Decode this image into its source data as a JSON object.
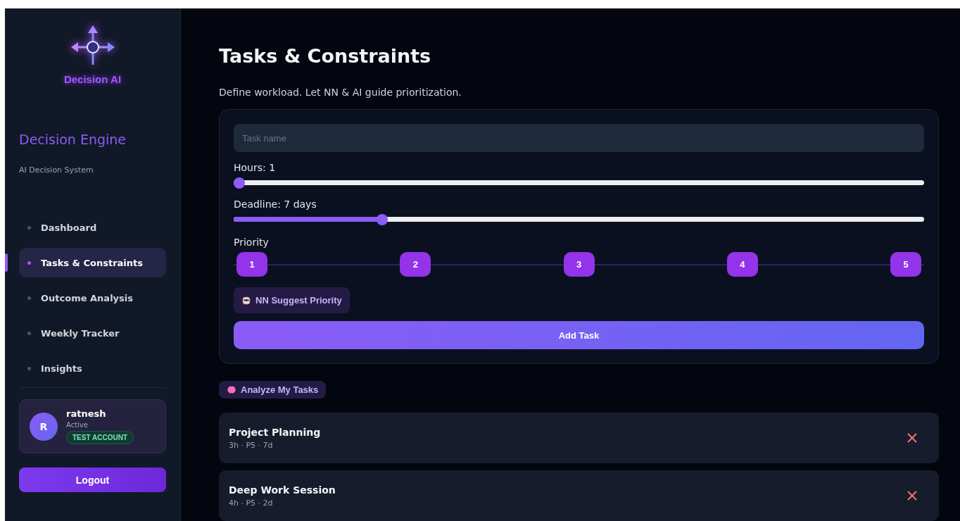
{
  "sidebar": {
    "logo_text": "Decision AI",
    "title": "Decision Engine",
    "subtitle": "AI Decision System",
    "nav": [
      {
        "label": "Dashboard",
        "selected": false
      },
      {
        "label": "Tasks & Constraints",
        "selected": true
      },
      {
        "label": "Outcome Analysis",
        "selected": false
      },
      {
        "label": "Weekly Tracker",
        "selected": false
      },
      {
        "label": "Insights",
        "selected": false
      }
    ],
    "user": {
      "initial": "R",
      "name": "ratnesh",
      "status": "Active",
      "badge": "TEST ACCOUNT"
    },
    "logout": "Logout"
  },
  "main": {
    "title": "Tasks & Constraints",
    "subtitle": "Define workload. Let NN & AI guide prioritization.",
    "form": {
      "task_placeholder": "Task name",
      "sliders": [
        {
          "label": "Hours: 1",
          "level": 0
        },
        {
          "label": "Deadline: 7 days",
          "level": 0.21
        }
      ],
      "priority_label": "Priority",
      "priorities": [
        "1",
        "2",
        "3",
        "4",
        "5"
      ],
      "suggest_button": "NN Suggest Priority",
      "add_button": "Add Task"
    },
    "analyze_button": "Analyze My Tasks",
    "tasks": [
      {
        "name": "Project Planning",
        "meta": "3h · P5 · 7d"
      },
      {
        "name": "Deep Work Session",
        "meta": "4h · P5 · 2d"
      }
    ]
  }
}
